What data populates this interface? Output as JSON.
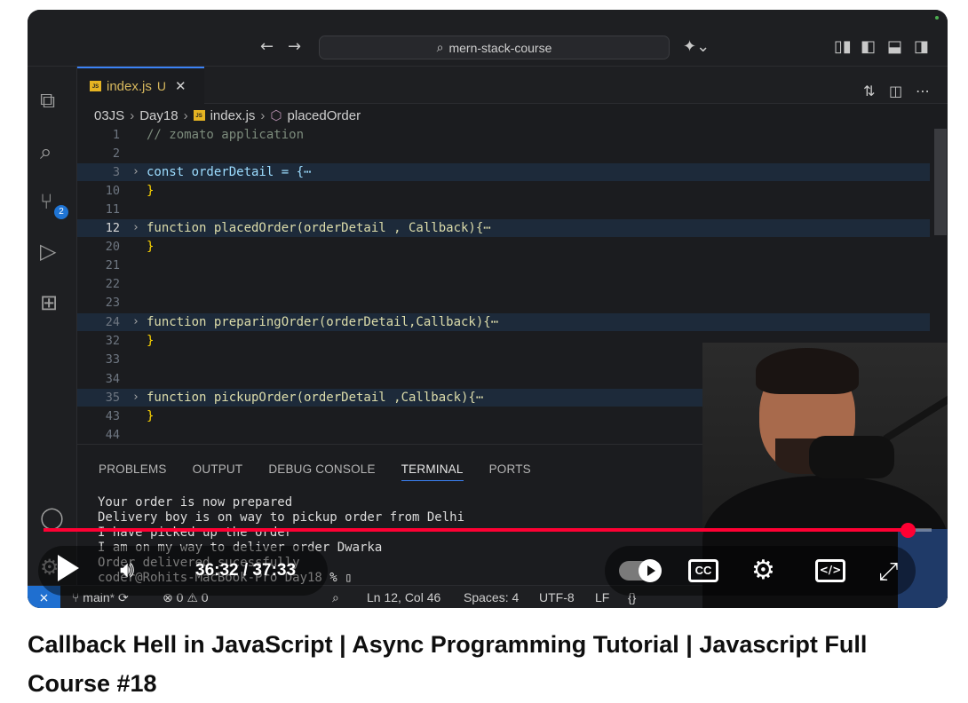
{
  "window": {
    "search_label": "mern-stack-course"
  },
  "activity": {
    "scm_badge": "2"
  },
  "tab": {
    "name": "index.js",
    "status": "U",
    "file_type": "JS"
  },
  "breadcrumb": {
    "items": [
      "03JS",
      "Day18",
      "index.js",
      "placedOrder"
    ]
  },
  "editor": {
    "lines": [
      {
        "num": "1",
        "text": "// zomato application"
      },
      {
        "num": "2",
        "text": ""
      },
      {
        "num": "3",
        "text": "const orderDetail = {⋯"
      },
      {
        "num": "10",
        "text": "}"
      },
      {
        "num": "11",
        "text": ""
      },
      {
        "num": "12",
        "text": "function placedOrder(orderDetail , Callback){⋯"
      },
      {
        "num": "20",
        "text": "}"
      },
      {
        "num": "21",
        "text": ""
      },
      {
        "num": "22",
        "text": ""
      },
      {
        "num": "23",
        "text": ""
      },
      {
        "num": "24",
        "text": "function preparingOrder(orderDetail,Callback){⋯"
      },
      {
        "num": "32",
        "text": "}"
      },
      {
        "num": "33",
        "text": ""
      },
      {
        "num": "34",
        "text": ""
      },
      {
        "num": "35",
        "text": "function pickupOrder(orderDetail ,Callback){⋯"
      },
      {
        "num": "43",
        "text": "}"
      },
      {
        "num": "44",
        "text": ""
      }
    ]
  },
  "panel": {
    "tabs": [
      "PROBLEMS",
      "OUTPUT",
      "DEBUG CONSOLE",
      "TERMINAL",
      "PORTS"
    ],
    "active_tab": "TERMINAL",
    "terminal_lines": [
      "Your order is now prepared",
      "Delivery boy is on way to pickup order from Delhi",
      "I have picked up the order",
      "I am on my way to deliver order Dwarka",
      "Order delivered sucessfully",
      "coder@Rohits-MacBook-Pro Day18 % ▯"
    ]
  },
  "statusbar": {
    "branch": "main*",
    "errors": "0",
    "warnings": "0",
    "position": "Ln 12, Col 46",
    "spaces": "Spaces: 4",
    "encoding": "UTF-8",
    "eol": "LF",
    "language_icon": "{}"
  },
  "player": {
    "time_display": "36:32 / 37:33",
    "progress": 0.973,
    "cc_label": "CC",
    "accent_color": "#ff0033"
  },
  "video": {
    "title": "Callback Hell in JavaScript | Async Programming Tutorial | Javascript Full Course #18"
  }
}
